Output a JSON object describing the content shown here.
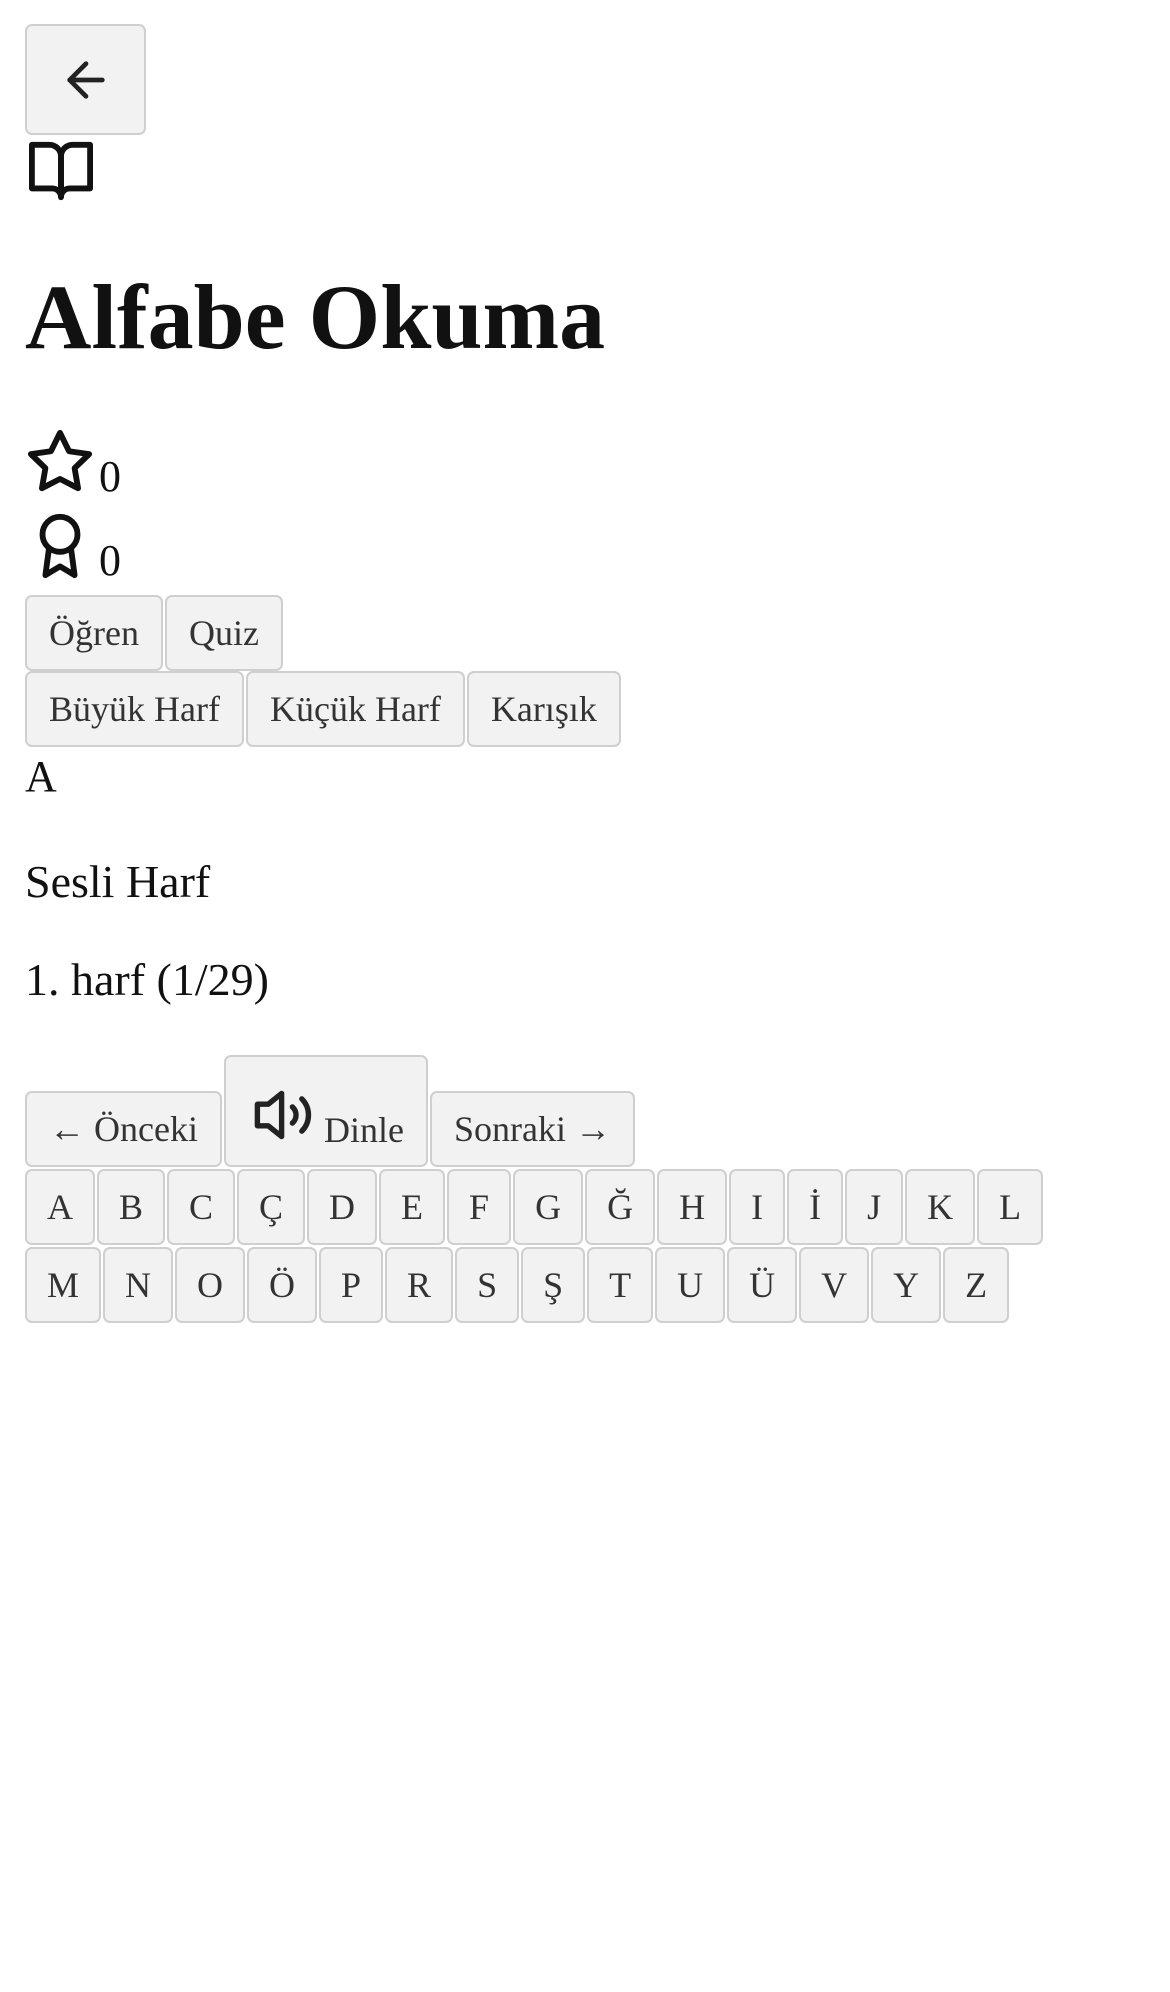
{
  "header": {
    "back_icon": "arrow-left-icon",
    "book_icon": "open-book-icon",
    "title": "Alfabe Okuma"
  },
  "stats": {
    "stars": {
      "icon": "star-icon",
      "value": "0"
    },
    "badges": {
      "icon": "award-ribbon-icon",
      "value": "0"
    }
  },
  "mode_tabs": [
    "Öğren",
    "Quiz"
  ],
  "case_tabs": [
    "Büyük Harf",
    "Küçük Harf",
    "Karışık"
  ],
  "current": {
    "letter": "A",
    "kind": "Sesli Harf",
    "position": "1. harf (1/29)"
  },
  "controls": {
    "prev": "← Önceki",
    "listen": "Dinle",
    "listen_icon": "speaker-volume-icon",
    "next": "Sonraki →"
  },
  "alphabet": {
    "row1": [
      "A",
      "B",
      "C",
      "Ç",
      "D",
      "E",
      "F",
      "G",
      "Ğ",
      "H",
      "I",
      "İ",
      "J",
      "K",
      "L"
    ],
    "row2": [
      "M",
      "N",
      "O",
      "Ö",
      "P",
      "R",
      "S",
      "Ş",
      "T",
      "U",
      "Ü",
      "V",
      "Y",
      "Z"
    ]
  }
}
